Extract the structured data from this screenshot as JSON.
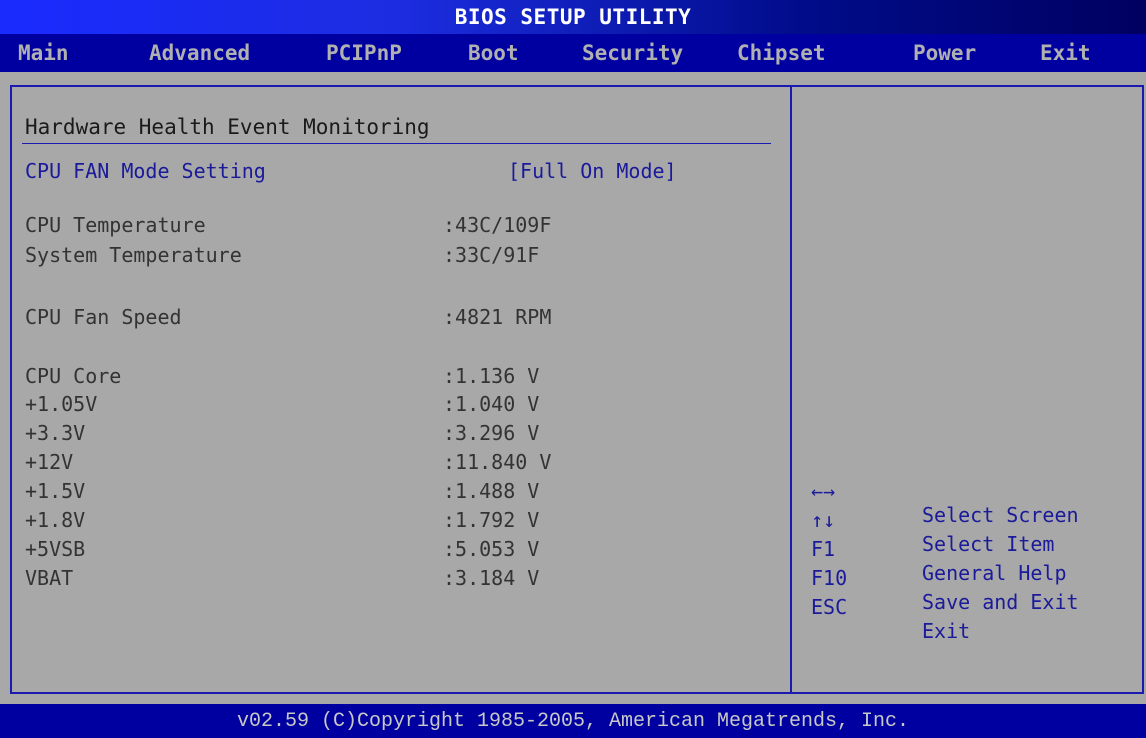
{
  "title": "BIOS SETUP UTILITY",
  "menu": [
    "Main",
    "Advanced",
    "PCIPnP",
    "Boot",
    "Security",
    "Chipset",
    "Power",
    "Exit"
  ],
  "section_title": "Hardware Health Event Monitoring",
  "setting": {
    "label": "CPU FAN Mode Setting",
    "value": "[Full On Mode]"
  },
  "readings": [
    {
      "label": "CPU Temperature",
      "value": ":43C/109F"
    },
    {
      "label": "System Temperature",
      "value": ":33C/91F"
    },
    {
      "label": "CPU Fan Speed",
      "value": ":4821 RPM"
    },
    {
      "label": "CPU Core",
      "value": ":1.136 V"
    },
    {
      "label": "+1.05V",
      "value": ":1.040 V"
    },
    {
      "label": "+3.3V",
      "value": ":3.296 V"
    },
    {
      "label": "+12V",
      "value": ":11.840 V"
    },
    {
      "label": "+1.5V",
      "value": ":1.488 V"
    },
    {
      "label": "+1.8V",
      "value": ":1.792 V"
    },
    {
      "label": "+5VSB",
      "value": ":5.053 V"
    },
    {
      "label": "VBAT",
      "value": ":3.184 V"
    }
  ],
  "help": [
    {
      "key": "←→",
      "desc": "Select Screen"
    },
    {
      "key": "↑↓",
      "desc": "Select Item"
    },
    {
      "key": "F1",
      "desc": "General Help"
    },
    {
      "key": "F10",
      "desc": "Save and Exit"
    },
    {
      "key": "ESC",
      "desc": "Exit"
    }
  ],
  "footer": "v02.59 (C)Copyright 1985-2005, American Megatrends, Inc."
}
